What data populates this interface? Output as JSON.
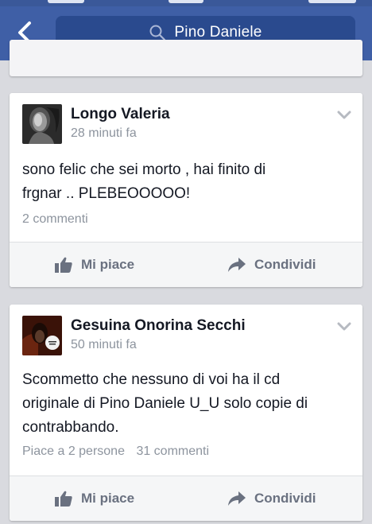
{
  "header": {
    "search_query": "Pino Daniele"
  },
  "posts": [
    {
      "author": "Longo Valeria",
      "time": "28 minuti fa",
      "text_lines": [
        "sono felic che sei morto , hai finito di",
        "frgnar .. PLEBEOOOOO!"
      ],
      "likes": "",
      "comments": "2 commenti",
      "like_label": "Mi piace",
      "share_label": "Condividi"
    },
    {
      "author": "Gesuina Onorina Secchi",
      "time": "50 minuti fa",
      "text_lines": [
        "Scommetto che nessuno di voi ha il cd",
        "originale di Pino Daniele U_U solo copie di",
        "contrabbando."
      ],
      "likes": "Piace a 2 persone",
      "comments": "31 commenti",
      "like_label": "Mi piace",
      "share_label": "Condividi"
    }
  ],
  "colors": {
    "header": "#3f5fa6",
    "search_field": "#2a4a8e",
    "background": "#d9dadf",
    "action_text": "#6a7180"
  },
  "icons": {
    "back": "back-arrow-icon",
    "search": "search-icon",
    "options": "chevron-down-icon",
    "like": "thumbs-up-icon",
    "share": "share-arrow-icon"
  }
}
